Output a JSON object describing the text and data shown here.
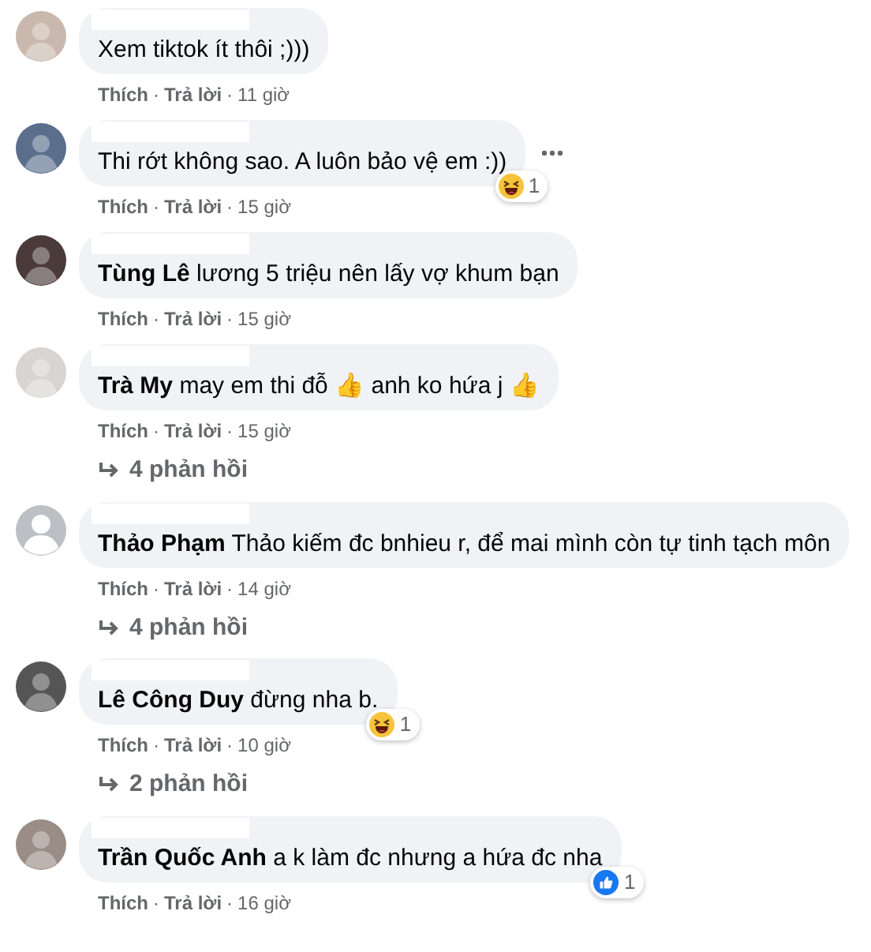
{
  "separator": "·",
  "comments": [
    {
      "avatar": {
        "kind": "photo",
        "color": "#c9b8ad"
      },
      "text": "Xem tiktok ít thôi ;)))",
      "like": "Thích",
      "reply": "Trả lời",
      "time": "11 giờ"
    },
    {
      "avatar": {
        "kind": "photo",
        "color": "#5b6e8c"
      },
      "text": "Thi rớt không sao. A luôn bảo vệ em :))",
      "like": "Thích",
      "reply": "Trả lời",
      "time": "15 giờ",
      "more_menu": true,
      "reaction": {
        "kind": "haha",
        "count": "1"
      }
    },
    {
      "avatar": {
        "kind": "photo",
        "color": "#4a3a3a"
      },
      "text": "**Tùng Lê** lương 5 triệu nên lấy vợ khum bạn",
      "like": "Thích",
      "reply": "Trả lời",
      "time": "15 giờ"
    },
    {
      "avatar": {
        "kind": "photo",
        "color": "#d8d4d2"
      },
      "text": "**Trà My** may em thi đỗ 👍 anh ko hứa j 👍",
      "like": "Thích",
      "reply": "Trả lời",
      "time": "15 giờ",
      "replies": "4 phản hồi"
    },
    {
      "avatar": {
        "kind": "default",
        "color": "#bcc0c4"
      },
      "text": "**Thảo Phạm** Thảo kiếm đc bnhieu r, để mai mình còn tự tinh tạch môn",
      "like": "Thích",
      "reply": "Trả lời",
      "time": "14 giờ",
      "replies": "4 phản hồi"
    },
    {
      "avatar": {
        "kind": "photo",
        "color": "#555555"
      },
      "text": "**Lê Công Duy** đừng nha b.",
      "like": "Thích",
      "reply": "Trả lời",
      "time": "10 giờ",
      "replies": "2 phản hồi",
      "reaction": {
        "kind": "haha",
        "count": "1"
      }
    },
    {
      "avatar": {
        "kind": "photo",
        "color": "#9a8d85"
      },
      "text": "**Trần Quốc Anh** a k làm đc nhưng a hứa đc nha",
      "like": "Thích",
      "reply": "Trả lời",
      "time": "16 giờ",
      "reaction": {
        "kind": "like",
        "count": "1"
      }
    }
  ]
}
